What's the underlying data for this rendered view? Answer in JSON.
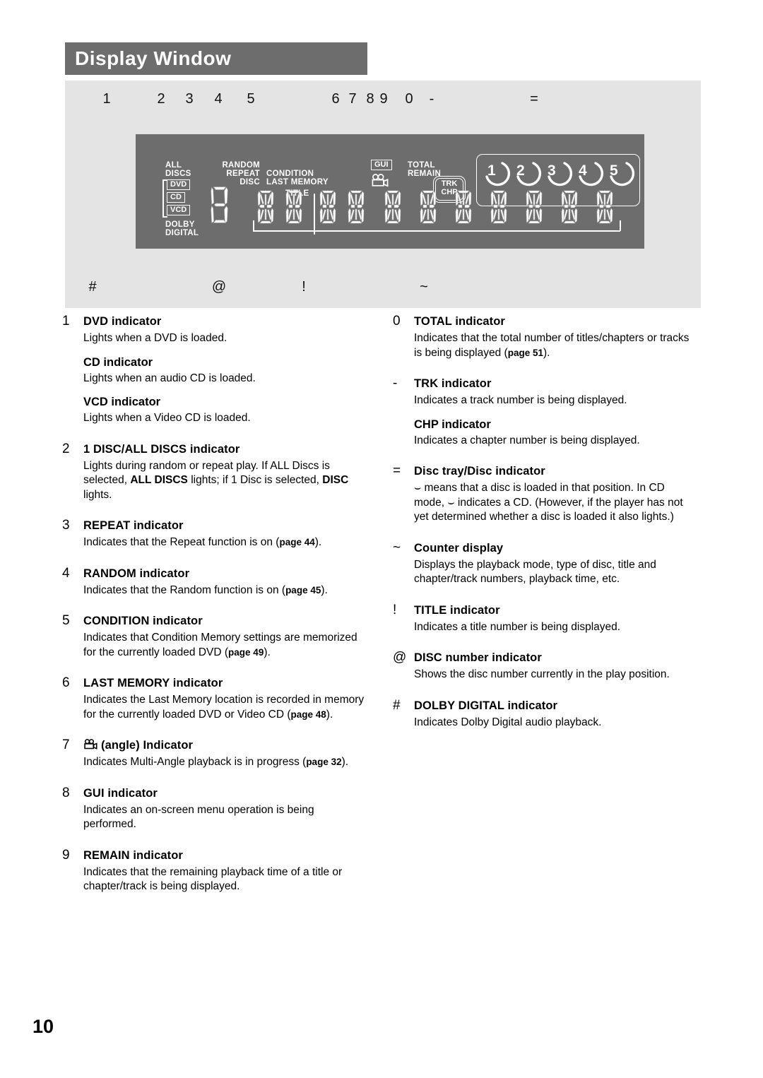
{
  "header": {
    "title": "Display Window"
  },
  "page": {
    "number": "10"
  },
  "figure": {
    "top_callouts": [
      "1",
      "2",
      "3",
      "4",
      "5",
      "6",
      "7",
      "8",
      "9",
      "0",
      "-",
      "="
    ],
    "bottom_callouts": [
      "#",
      "@",
      "!",
      "~"
    ],
    "panel_labels": {
      "all": "ALL",
      "discs": "DISCS",
      "dvd": "DVD",
      "cd": "CD",
      "vcd": "VCD",
      "dolby": "DOLBY",
      "digital": "DIGITAL",
      "random": "RANDOM",
      "repeat": "REPEAT",
      "disc": "DISC",
      "condition": "CONDITION",
      "last_memory": "LAST MEMORY",
      "title": "TITLE",
      "gui": "GUI",
      "angle_icon": "angle-camera-icon",
      "total": "TOTAL",
      "remain": "REMAIN",
      "trk": "TRK",
      "chp": "CHP"
    },
    "disc_numbers": [
      "1",
      "2",
      "3",
      "4",
      "5"
    ]
  },
  "left_column": [
    {
      "marker": "1",
      "heading": "DVD indicator",
      "desc": "Lights when a DVD is loaded.",
      "sub": [
        {
          "heading": "CD indicator",
          "desc": "Lights when an audio CD is loaded."
        },
        {
          "heading": "VCD indicator",
          "desc": "Lights when a Video CD is loaded."
        }
      ]
    },
    {
      "marker": "2",
      "heading": "1 DISC/ALL DISCS indicator",
      "desc_parts": [
        {
          "text": "Lights during random or repeat play. If ALL Discs is selected, ",
          "bold": false
        },
        {
          "text": "ALL DISCS",
          "bold": true
        },
        {
          "text": " lights; if 1 Disc is selected, ",
          "bold": false
        },
        {
          "text": "DISC",
          "bold": true
        },
        {
          "text": " lights.",
          "bold": false
        }
      ]
    },
    {
      "marker": "3",
      "heading": "REPEAT indicator",
      "desc_pre": "Indicates that the Repeat function is on (",
      "page_ref": "page 44",
      "desc_post": ")."
    },
    {
      "marker": "4",
      "heading": "RANDOM indicator",
      "desc_pre": "Indicates that the Random function is on (",
      "page_ref": "page 45",
      "desc_post": ")."
    },
    {
      "marker": "5",
      "heading": "CONDITION indicator",
      "desc_pre": "Indicates that Condition Memory settings are memorized for the currently loaded DVD (",
      "page_ref": "page 49",
      "desc_post": ")."
    },
    {
      "marker": "6",
      "heading": "LAST MEMORY indicator",
      "desc_pre": "Indicates the Last Memory location is recorded in memory for the currently loaded DVD or Video CD (",
      "page_ref": "page 48",
      "desc_post": ")."
    },
    {
      "marker": "7",
      "heading": "(angle) Indicator",
      "desc_pre": "Indicates Multi-Angle playback is in progress (",
      "page_ref": "page 32",
      "desc_post": ")."
    },
    {
      "marker": "8",
      "heading": "GUI indicator",
      "desc": "Indicates an on-screen menu operation is being performed."
    },
    {
      "marker": "9",
      "heading": "REMAIN indicator",
      "desc": "Indicates that the remaining playback time of a title or chapter/track is being displayed."
    }
  ],
  "right_column": [
    {
      "marker": "0",
      "heading": "TOTAL indicator",
      "desc_pre": "Indicates that the total number of titles/chapters or tracks is being displayed (",
      "page_ref": "page 51",
      "desc_post": ")."
    },
    {
      "marker": "-",
      "heading": "TRK indicator",
      "desc": "Indicates a track number is being displayed.",
      "sub": [
        {
          "heading": "CHP indicator",
          "desc": "Indicates a chapter number is being displayed."
        }
      ]
    },
    {
      "marker": "=",
      "heading": "Disc tray/Disc indicator",
      "desc_glyph": "⌣ means that a disc is loaded in that position. In CD mode, ⌣ indicates a CD. (However, if the player has not yet determined whether a disc is loaded it also lights.)"
    },
    {
      "marker": "~",
      "heading": "Counter display",
      "desc": "Displays the playback mode, type of disc, title and chapter/track numbers, playback time, etc."
    },
    {
      "marker": "!",
      "heading": "TITLE indicator",
      "desc": "Indicates a title number is being displayed."
    },
    {
      "marker": "@",
      "heading": "DISC number indicator",
      "desc": "Shows the disc number currently in the play position."
    },
    {
      "marker": "#",
      "heading": "DOLBY DIGITAL indicator",
      "desc": "Indicates Dolby Digital audio playback."
    }
  ]
}
